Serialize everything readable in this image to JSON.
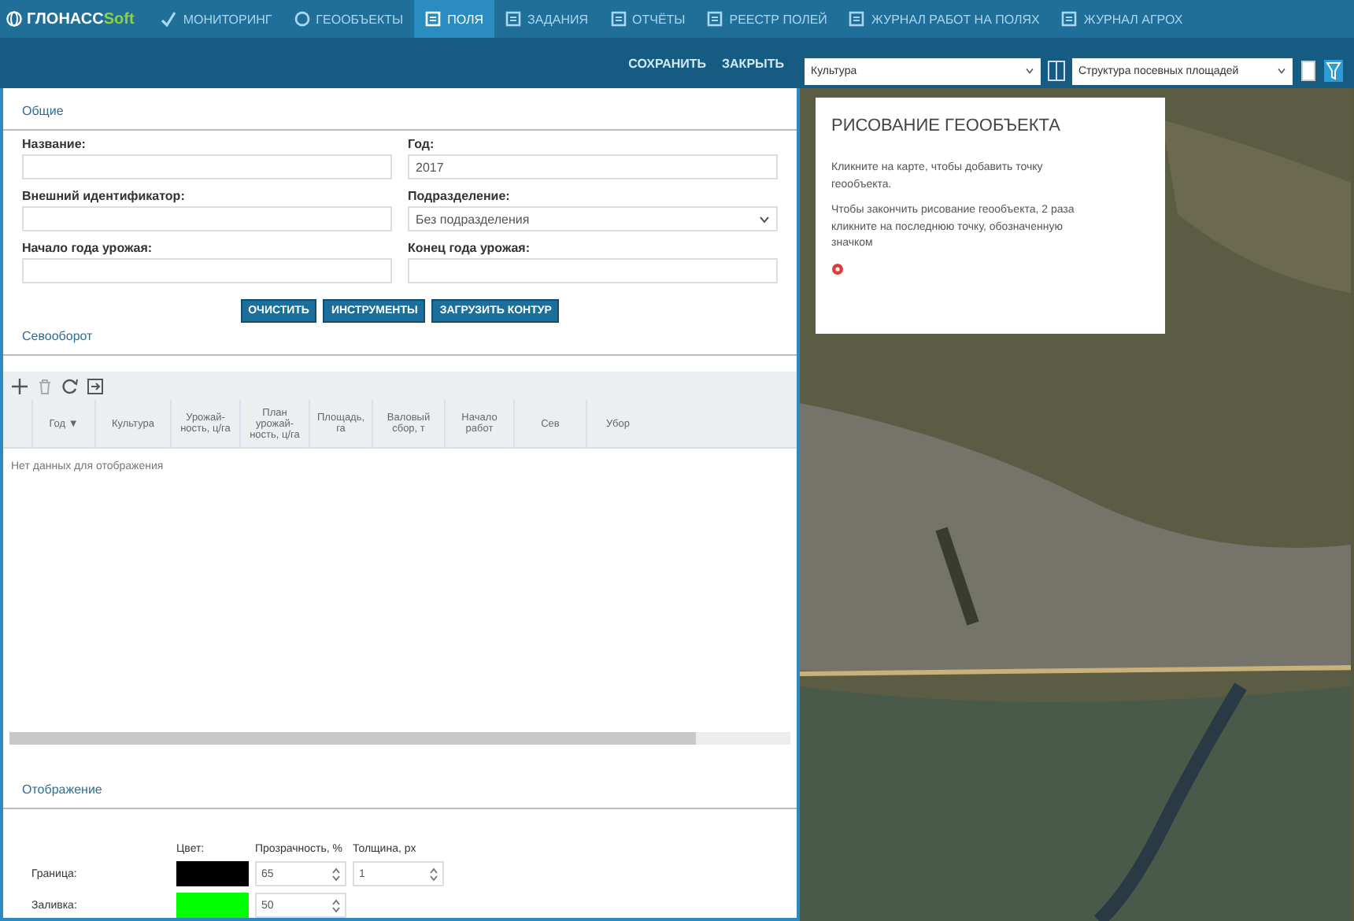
{
  "nav": {
    "logo": {
      "main": "ГЛОНАСС",
      "accent": "Soft"
    },
    "items": [
      {
        "label": "МОНИТОРИНГ",
        "selected": false
      },
      {
        "label": "ГЕООБЪЕКТЫ",
        "selected": false
      },
      {
        "label": "ПОЛЯ",
        "selected": true
      },
      {
        "label": "ЗАДАНИЯ",
        "selected": false
      },
      {
        "label": "ОТЧЁТЫ",
        "selected": false
      },
      {
        "label": "РЕЕСТР ПОЛЕЙ",
        "selected": false
      },
      {
        "label": "ЖУРНАЛ РАБОТ НА ПОЛЯХ",
        "selected": false
      },
      {
        "label": "ЖУРНАЛ АГРОХ",
        "selected": false
      }
    ]
  },
  "toolbar": {
    "buttons": [
      "СОХРАНИТЬ",
      "ЗАКРЫТЬ"
    ]
  },
  "map_controls": {
    "layer_select": "Культура",
    "structure_select": "Структура посевных площадей"
  },
  "form": {
    "section_title": "Общие",
    "fields": [
      {
        "label": "Название:",
        "kind": "text"
      },
      {
        "label": "Год:",
        "value": "2017",
        "kind": "text"
      },
      {
        "label": "Внешний идентификатор:",
        "kind": "text"
      },
      {
        "label": "Подразделение:",
        "value": "Без подразделения",
        "kind": "select"
      },
      {
        "label": "Начало года урожая:",
        "kind": "text"
      },
      {
        "label": "Конец года урожая:",
        "kind": "text"
      }
    ],
    "buttons": [
      "ОЧИСТИТЬ",
      "ИНСТРУМЕНТЫ",
      "ЗАГРУЗИТЬ КОНТУР"
    ]
  },
  "rotation": {
    "title": "Севооборот",
    "columns": [
      "Год ▼",
      "Культура",
      "Урожай-ность, ц/га",
      "План урожай-ность, ц/га",
      "Площадь, га",
      "Валовый сбор, т",
      "Начало работ",
      "Сев",
      "Убор"
    ],
    "empty_message": "Нет данных для отображения"
  },
  "display": {
    "title": "Отображение",
    "headers": [
      "Цвет:",
      "Прозрачность, %",
      "Толщина, px"
    ],
    "rows": [
      {
        "label": "Граница:",
        "color": "#000000",
        "opacity": "65",
        "thickness": "1"
      },
      {
        "label": "Заливка:",
        "color": "#00ff00",
        "opacity": "50"
      }
    ]
  },
  "map": {
    "popup": {
      "title": "РИСОВАНИЕ ГЕООБЪЕКТА",
      "paragraphs": [
        "Кликните на карте, чтобы добавить точку геообъекта.",
        "Чтобы закончить рисование геообъекта, 2 раза кликните на последнюю точку, обозначенную значком"
      ]
    }
  }
}
